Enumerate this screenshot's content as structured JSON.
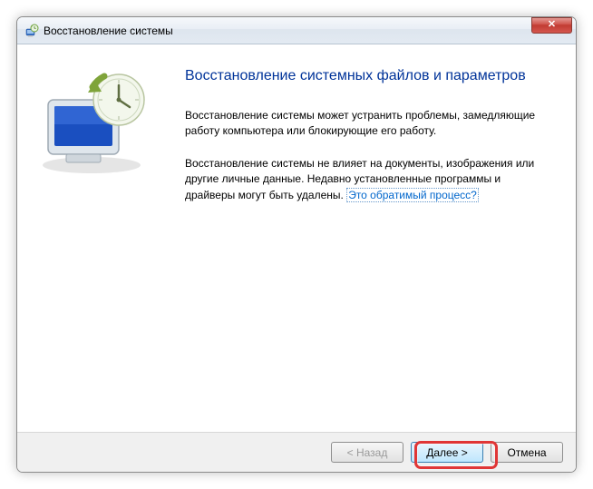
{
  "window": {
    "title": "Восстановление системы"
  },
  "content": {
    "heading": "Восстановление системных файлов и параметров",
    "para1": "Восстановление системы может устранить проблемы, замедляющие работу компьютера или блокирующие его работу.",
    "para2_pre": "Восстановление системы не влияет на документы, изображения или другие личные данные. Недавно установленные программы и драйверы могут быть удалены. ",
    "para2_link": "Это обратимый процесс?"
  },
  "buttons": {
    "back": "< Назад",
    "next": "Далее >",
    "cancel": "Отмена"
  },
  "icons": {
    "title": "system-restore-icon",
    "close": "close-icon"
  }
}
